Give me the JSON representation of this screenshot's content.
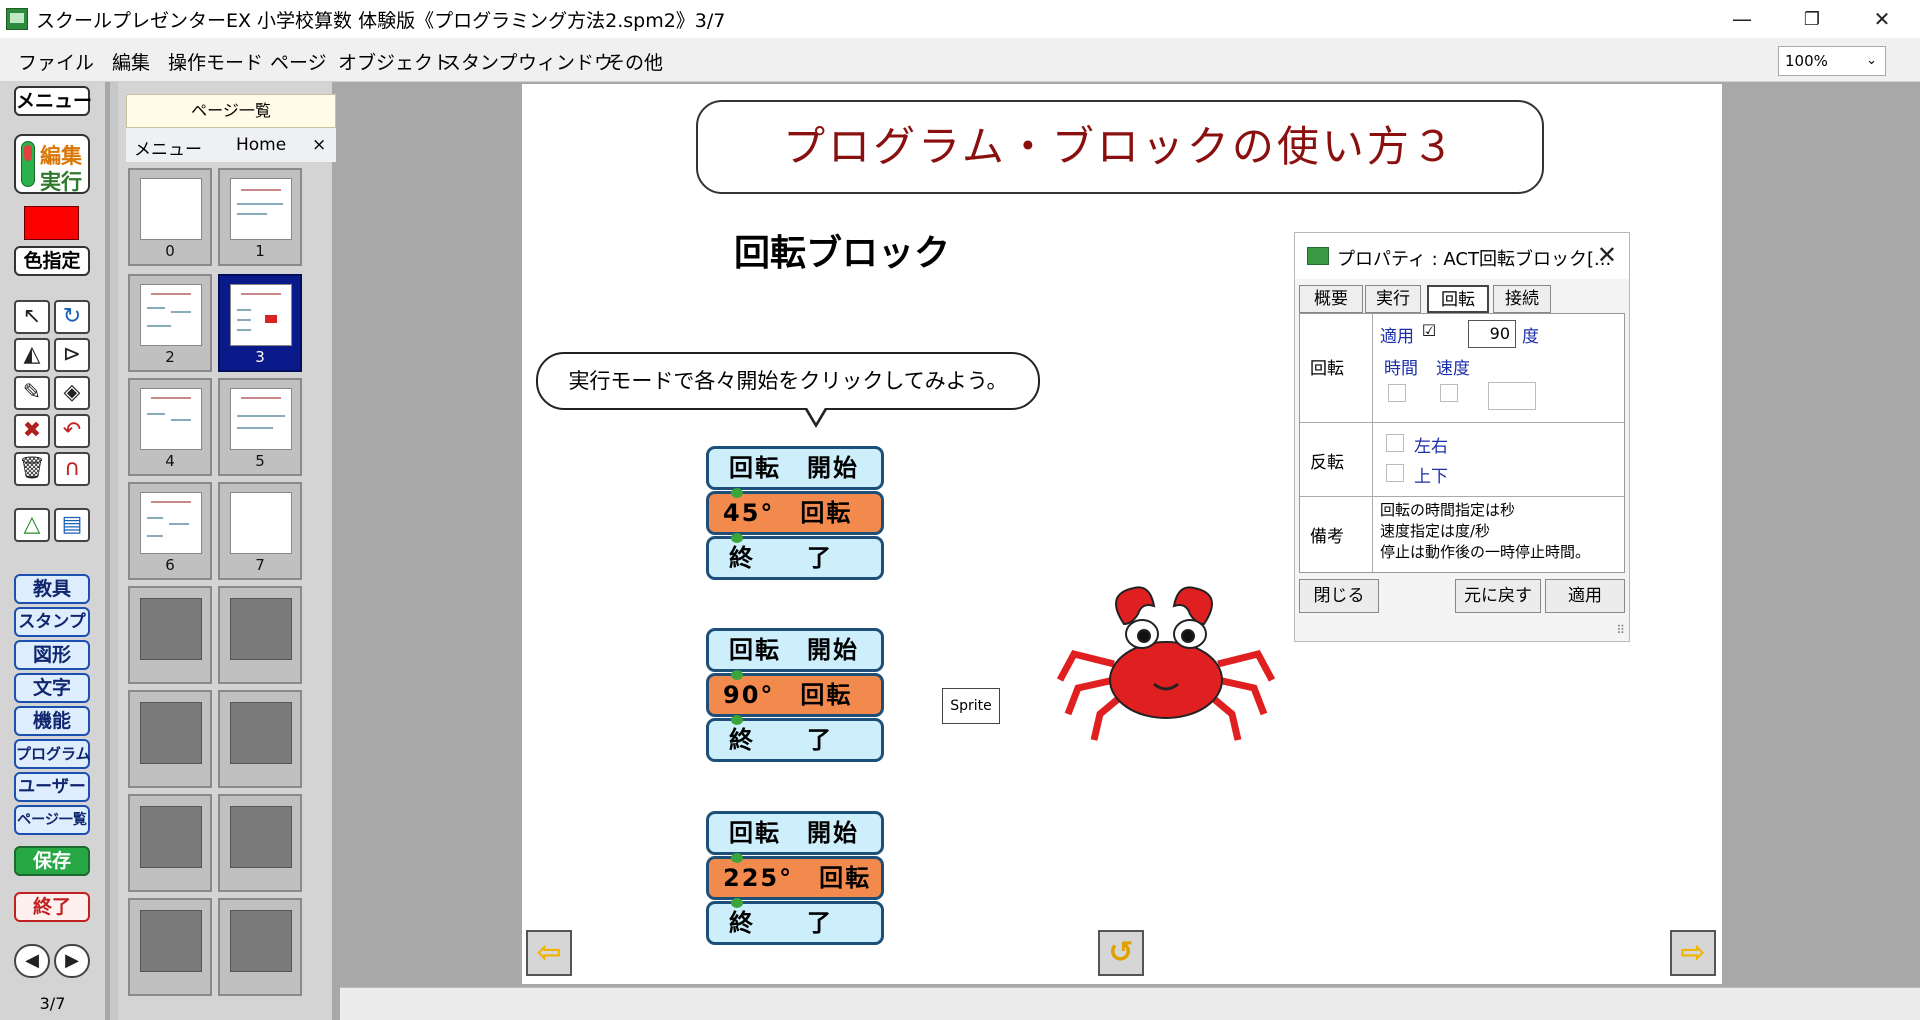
{
  "window": {
    "title": "スクールプレゼンターEX 小学校算数 体験版《プログラミング方法2.spm2》3/7",
    "minimize": "—",
    "restore": "❐",
    "close": "✕"
  },
  "menubar": {
    "items": [
      "ファイル",
      "編集",
      "操作モード",
      "ページ",
      "オブジェクト",
      "スタンプ",
      "ウィンドウ",
      "その他"
    ],
    "zoom": "100%"
  },
  "toolpanel": {
    "menu_label": "メニュー",
    "mode_edit": "編集",
    "mode_run": "実行",
    "color_label": "色指定",
    "swatch_color": "#ff0000",
    "categories": [
      "教具",
      "スタンプ",
      "図形",
      "文字",
      "機能",
      "プログラム",
      "ユーザー",
      "ページ一覧"
    ],
    "save_label": "保存",
    "quit_label": "終了",
    "page_counter": "3/7"
  },
  "pagepanel": {
    "header": "ページ一覧",
    "tab_menu": "メニュー",
    "tab_home": "Home",
    "tab_close": "×",
    "pages": [
      "0",
      "1",
      "2",
      "3",
      "4",
      "5",
      "6",
      "7"
    ],
    "selected_page": "3"
  },
  "slide": {
    "title": "プログラム・ブロックの使い方３",
    "subheading": "回転ブロック",
    "bubble": "実行モードで各々開始をクリックしてみよう。",
    "groups": [
      {
        "start": "回転　開始",
        "action": "45°　回転",
        "end": "終　　了"
      },
      {
        "start": "回転　開始",
        "action": "90°　回転",
        "end": "終　　了"
      },
      {
        "start": "回転　開始",
        "action": "225°　回転",
        "end": "終　　了"
      }
    ],
    "sprite_label": "Sprite"
  },
  "dialog": {
    "title": "プロパティ : ACT回転ブロック[...",
    "close": "✕",
    "tabs": [
      "概要",
      "実行",
      "回転",
      "接続"
    ],
    "active_tab": "回転",
    "rotation": {
      "row_label": "回転",
      "apply_label": "適用",
      "apply_checked": "☑",
      "degrees_value": "90",
      "degrees_unit": "度",
      "time_label": "時間",
      "speed_label": "速度"
    },
    "flip": {
      "row_label": "反転",
      "horizontal": "左右",
      "vertical": "上下"
    },
    "notes": {
      "row_label": "備考",
      "line1": "回転の時間指定は秒",
      "line2": "速度指定は度/秒",
      "line3": "停止は動作後の一時停止時間。"
    },
    "buttons": {
      "close": "閉じる",
      "revert": "元に戻す",
      "apply": "適用"
    }
  }
}
